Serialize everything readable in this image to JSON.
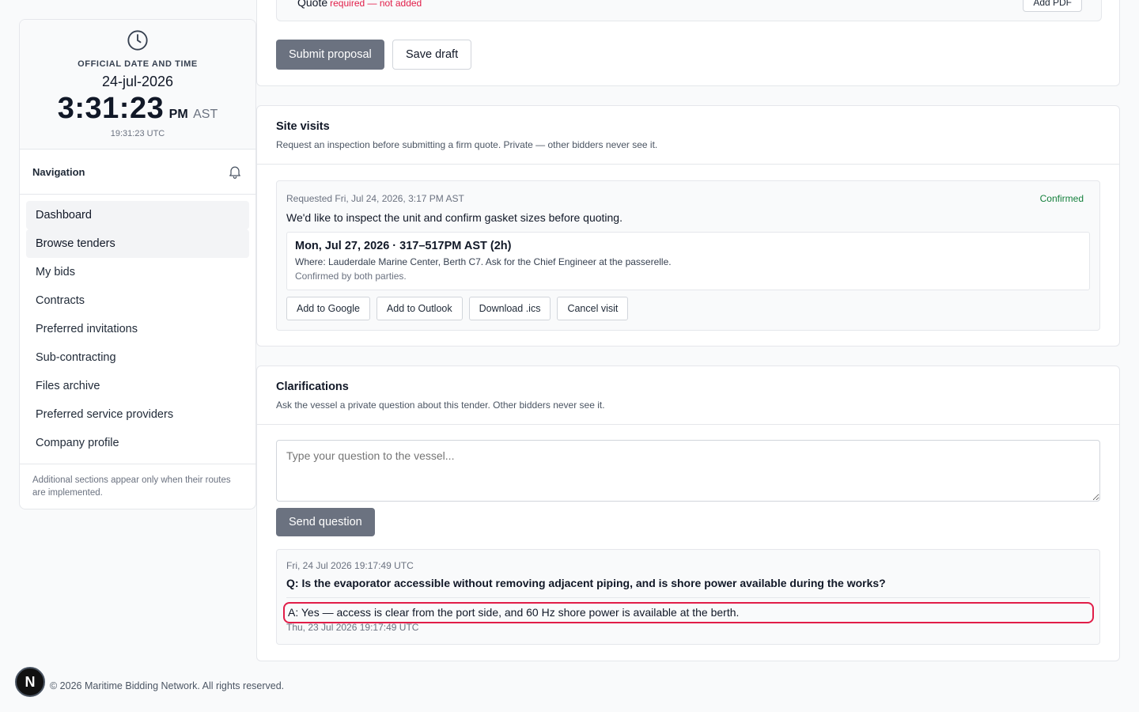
{
  "clock": {
    "label": "OFFICIAL DATE AND TIME",
    "date": "24-jul-2026",
    "time": "3:31:23",
    "ampm": "PM",
    "tz": "AST",
    "utc": "19:31:23 UTC"
  },
  "navigation": {
    "title": "Navigation",
    "items": [
      {
        "label": "Dashboard"
      },
      {
        "label": "Browse tenders"
      },
      {
        "label": "My bids"
      },
      {
        "label": "Contracts"
      },
      {
        "label": "Preferred invitations"
      },
      {
        "label": "Sub-contracting"
      },
      {
        "label": "Files archive"
      },
      {
        "label": "Preferred service providers"
      },
      {
        "label": "Company profile"
      }
    ],
    "note": "Additional sections appear only when their routes are implemented."
  },
  "proposal": {
    "quote_label": "Quote",
    "quote_status": "required — not added",
    "add_pdf_label": "Add PDF",
    "submit_label": "Submit proposal",
    "save_label": "Save draft"
  },
  "site_visits": {
    "title": "Site visits",
    "subtitle": "Request an inspection before submitting a firm quote. Private — other bidders never see it.",
    "visit": {
      "requested": "Requested Fri, Jul 24, 2026, 3:17 PM AST",
      "status": "Confirmed",
      "message": "We'd like to inspect the unit and confirm gasket sizes before quoting.",
      "slot_time": "Mon, Jul 27, 2026 · 317–517PM AST (2h)",
      "where": "Where: Lauderdale Marine Center, Berth C7. Ask for the Chief Engineer at the passerelle.",
      "confirmed": "Confirmed by both parties.",
      "actions": {
        "google": "Add to Google",
        "outlook": "Add to Outlook",
        "ics": "Download .ics",
        "cancel": "Cancel visit"
      }
    }
  },
  "clarifications": {
    "title": "Clarifications",
    "subtitle": "Ask the vessel a private question about this tender. Other bidders never see it.",
    "placeholder": "Type your question to the vessel...",
    "send_label": "Send question",
    "thread": {
      "q_date": "Fri, 24 Jul 2026 19:17:49 UTC",
      "question": "Q: Is the evaporator accessible without removing adjacent piping, and is shore power available during the works?",
      "answer": "A: Yes — access is clear from the port side, and 60 Hz shore power is available at the berth.",
      "a_date": "Thu, 23 Jul 2026 19:17:49 UTC"
    }
  },
  "footer": {
    "text": "© 2026 Maritime Bidding Network. All rights reserved.",
    "badge": "N"
  }
}
